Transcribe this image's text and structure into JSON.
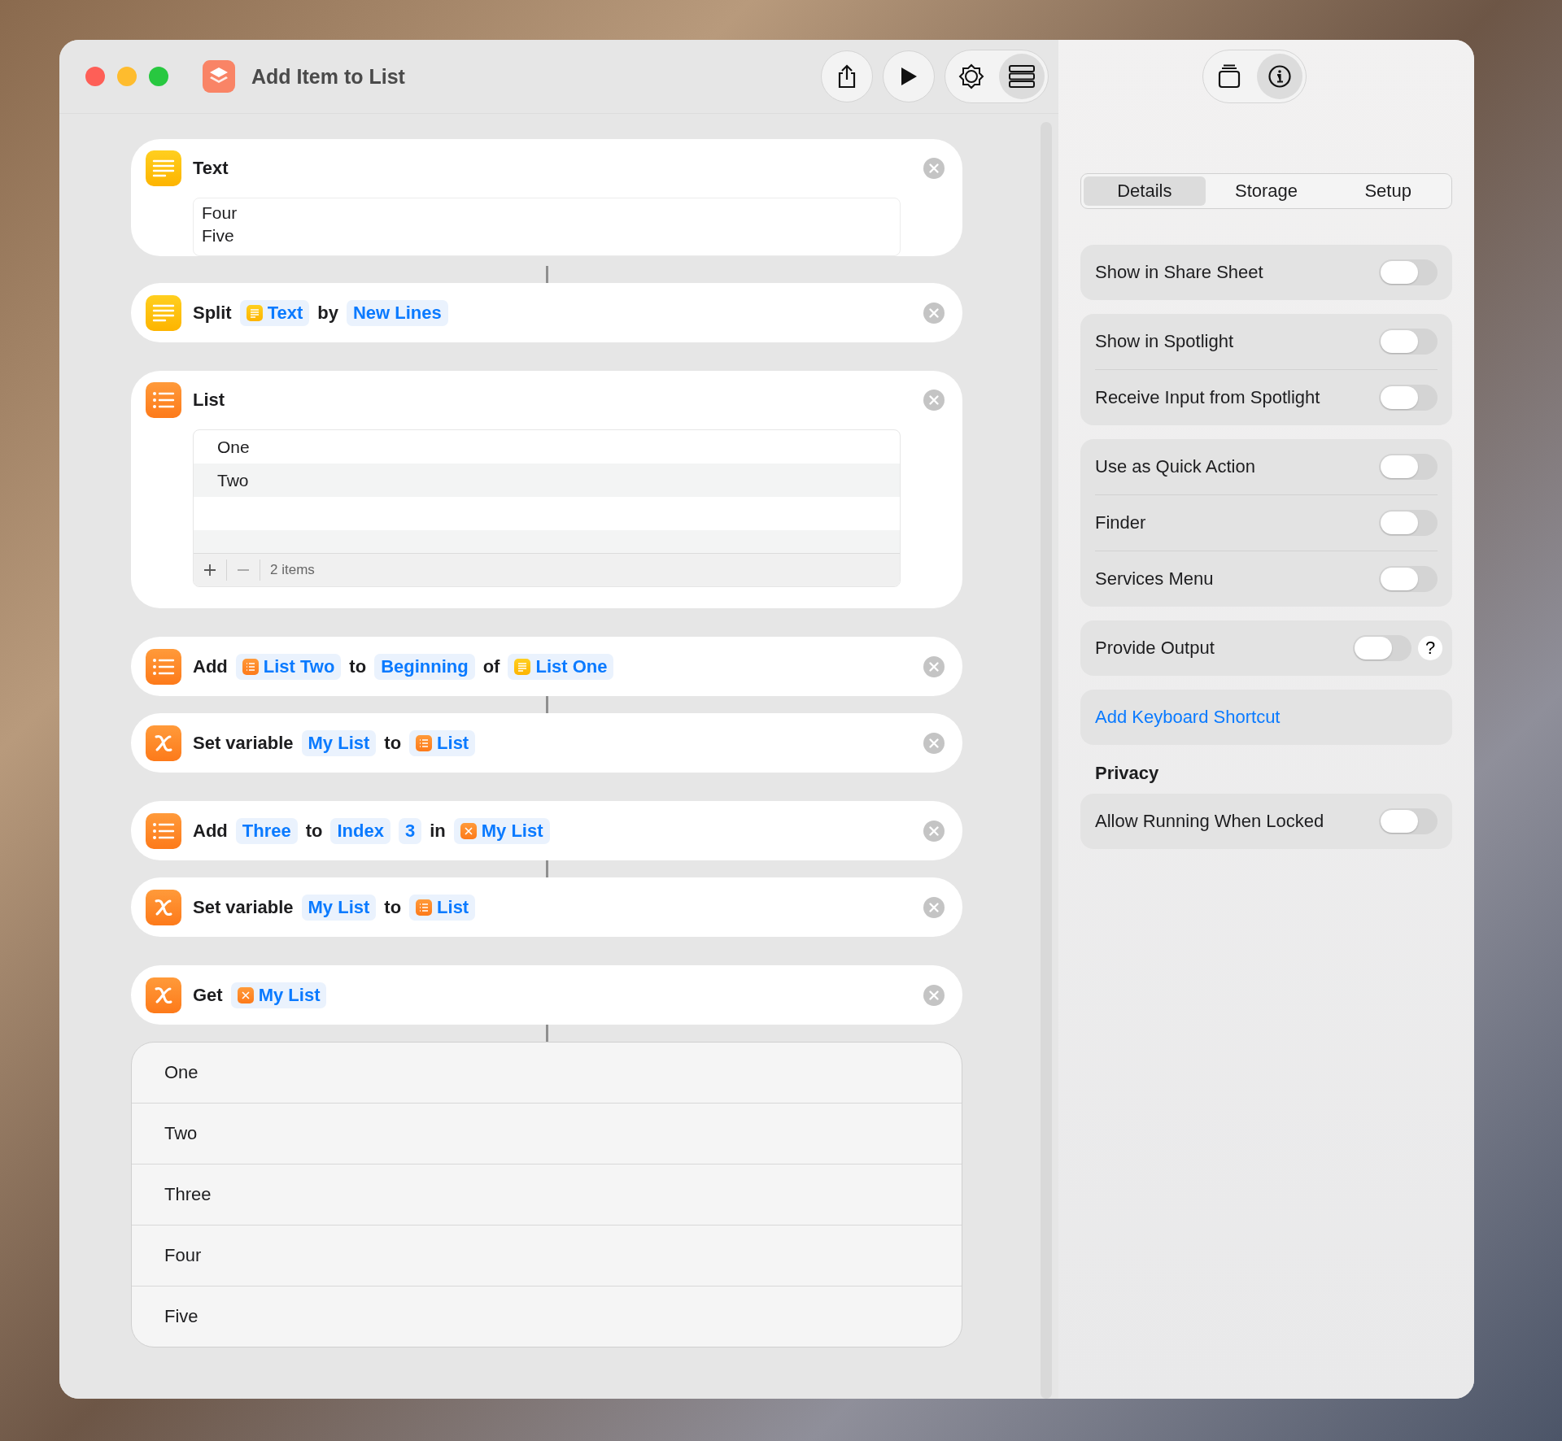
{
  "window": {
    "title": "Add Item to List"
  },
  "editor_toolbar": {
    "view_toggle": [
      {
        "kind": "gallery",
        "selected": false
      },
      {
        "kind": "list",
        "selected": true
      }
    ]
  },
  "sidebar_toolbar": [
    {
      "kind": "stack",
      "selected": false
    },
    {
      "kind": "info",
      "selected": true
    }
  ],
  "actions": [
    {
      "kind": "text",
      "title": "Text",
      "lines": [
        "Four",
        "Five"
      ],
      "connected": true
    },
    {
      "kind": "text-action",
      "parts": [
        {
          "kind": "word",
          "text": "Split"
        },
        {
          "kind": "text-token",
          "text": "Text"
        },
        {
          "kind": "word",
          "text": "by"
        },
        {
          "kind": "token",
          "text": "New Lines"
        }
      ],
      "connected": false
    },
    {
      "kind": "list",
      "title": "List",
      "items": [
        "One",
        "Two"
      ],
      "count": "2 items",
      "connected": false
    },
    {
      "kind": "list-action",
      "parts": [
        {
          "kind": "word",
          "text": "Add"
        },
        {
          "kind": "list-token",
          "text": "List Two"
        },
        {
          "kind": "word",
          "text": "to"
        },
        {
          "kind": "token",
          "text": "Beginning"
        },
        {
          "kind": "word",
          "text": "of"
        },
        {
          "kind": "text-token",
          "text": "List One"
        }
      ],
      "connected": true
    },
    {
      "kind": "variable-action",
      "parts": [
        {
          "kind": "word",
          "text": "Set variable"
        },
        {
          "kind": "token",
          "text": "My List"
        },
        {
          "kind": "word",
          "text": "to"
        },
        {
          "kind": "list-token",
          "text": "List"
        }
      ],
      "connected": false
    },
    {
      "kind": "list-action",
      "parts": [
        {
          "kind": "word",
          "text": "Add"
        },
        {
          "kind": "token",
          "text": "Three"
        },
        {
          "kind": "word",
          "text": "to"
        },
        {
          "kind": "token",
          "text": "Index"
        },
        {
          "kind": "token",
          "text": "3"
        },
        {
          "kind": "word",
          "text": "in"
        },
        {
          "kind": "variable-token",
          "text": "My List"
        }
      ],
      "connected": true
    },
    {
      "kind": "variable-action",
      "parts": [
        {
          "kind": "word",
          "text": "Set variable"
        },
        {
          "kind": "token",
          "text": "My List"
        },
        {
          "kind": "word",
          "text": "to"
        },
        {
          "kind": "list-token",
          "text": "List"
        }
      ],
      "connected": false
    },
    {
      "kind": "variable-action",
      "parts": [
        {
          "kind": "word",
          "text": "Get"
        },
        {
          "kind": "variable-token",
          "text": "My List"
        }
      ],
      "connected": true
    }
  ],
  "result": [
    "One",
    "Two",
    "Three",
    "Four",
    "Five"
  ],
  "sidebar": {
    "tabs": [
      {
        "label": "Details",
        "selected": true
      },
      {
        "label": "Storage",
        "selected": false
      },
      {
        "label": "Setup",
        "selected": false
      }
    ],
    "sections": [
      {
        "rows": [
          {
            "kind": "toggle",
            "label": "Show in Share Sheet",
            "on": false
          }
        ]
      },
      {
        "rows": [
          {
            "kind": "toggle",
            "label": "Show in Spotlight",
            "on": false
          },
          {
            "kind": "toggle",
            "label": "Receive Input from Spotlight",
            "on": false
          }
        ]
      },
      {
        "rows": [
          {
            "kind": "toggle",
            "label": "Use as Quick Action",
            "on": false
          },
          {
            "kind": "toggle",
            "label": "Finder",
            "on": false
          },
          {
            "kind": "toggle",
            "label": "Services Menu",
            "on": false
          }
        ]
      },
      {
        "rows": [
          {
            "kind": "toggle-help",
            "label": "Provide Output",
            "on": false,
            "help": "?"
          }
        ]
      },
      {
        "rows": [
          {
            "kind": "link",
            "label": "Add Keyboard Shortcut"
          }
        ]
      },
      {
        "heading": "Privacy",
        "rows": [
          {
            "kind": "toggle",
            "label": "Allow Running When Locked",
            "on": false
          }
        ]
      }
    ]
  }
}
